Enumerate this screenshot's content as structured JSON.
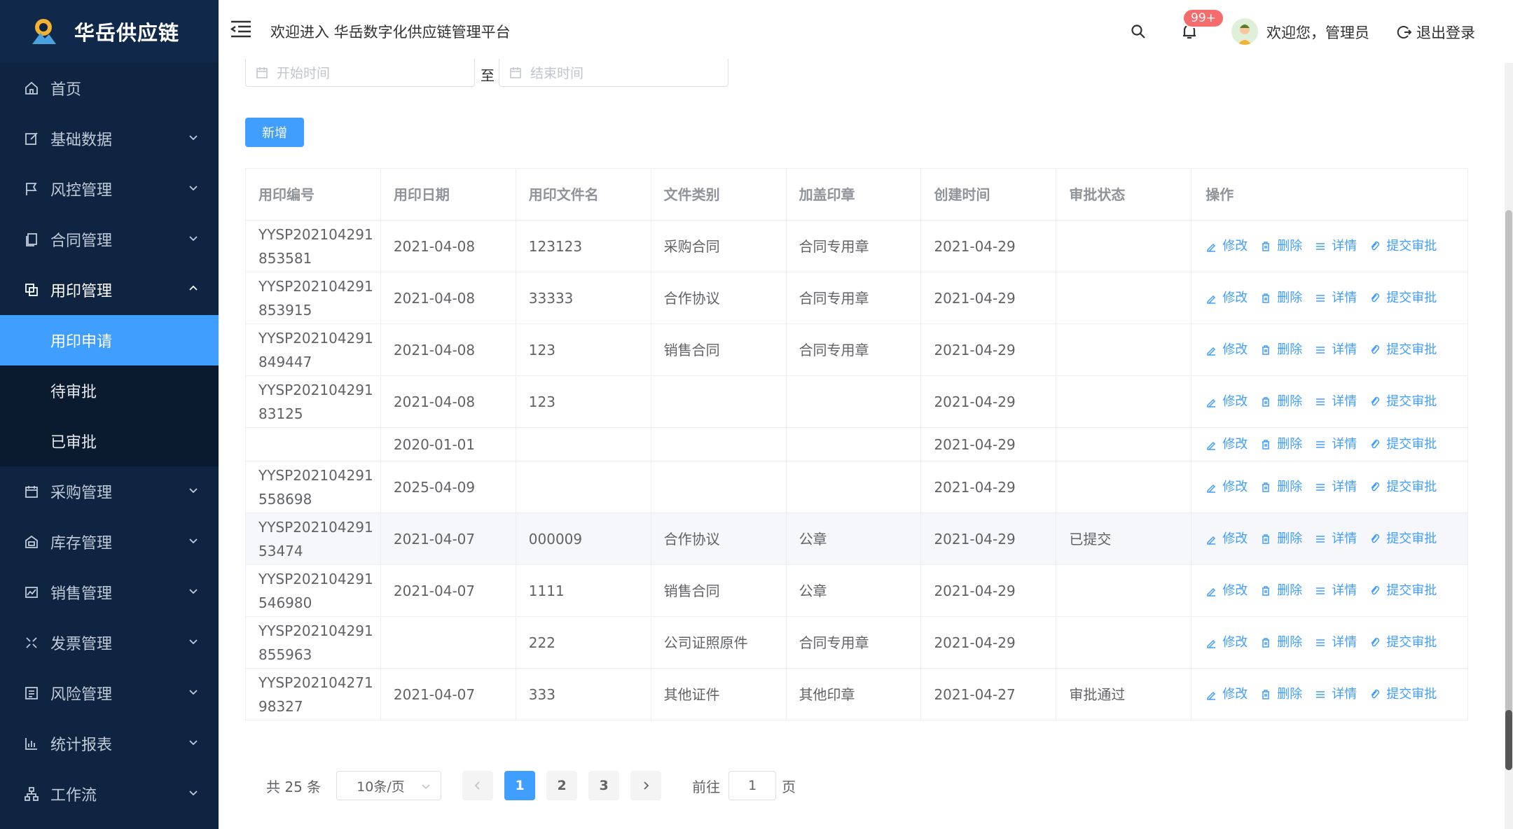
{
  "app": {
    "logo_text": "华岳供应链"
  },
  "header": {
    "welcome": "欢迎进入 华岳数字化供应链管理平台",
    "badge": "99+",
    "greeting": "欢迎您，管理员",
    "logout": "退出登录"
  },
  "sidebar": {
    "items": [
      {
        "label": "首页",
        "icon": "home-icon"
      },
      {
        "label": "基础数据",
        "icon": "edit-icon"
      },
      {
        "label": "风控管理",
        "icon": "flag-icon"
      },
      {
        "label": "合同管理",
        "icon": "document-copy-icon"
      },
      {
        "label": "用印管理",
        "icon": "copy-stamp-icon"
      },
      {
        "label": "用印申请",
        "icon": ""
      },
      {
        "label": "待审批",
        "icon": ""
      },
      {
        "label": "已审批",
        "icon": ""
      },
      {
        "label": "采购管理",
        "icon": "calendar-icon"
      },
      {
        "label": "库存管理",
        "icon": "warehouse-icon"
      },
      {
        "label": "销售管理",
        "icon": "trend-chart-icon"
      },
      {
        "label": "发票管理",
        "icon": "scan-icon"
      },
      {
        "label": "风险管理",
        "icon": "list-icon"
      },
      {
        "label": "统计报表",
        "icon": "bar-chart-icon"
      },
      {
        "label": "工作流",
        "icon": "org-chart-icon"
      }
    ]
  },
  "filters": {
    "start_placeholder": "开始时间",
    "separator": "至",
    "end_placeholder": "结束时间"
  },
  "toolbar": {
    "add_label": "新增"
  },
  "table": {
    "headers": [
      "用印编号",
      "用印日期",
      "用印文件名",
      "文件类别",
      "加盖印章",
      "创建时间",
      "审批状态",
      "操作"
    ],
    "ops": [
      "修改",
      "删除",
      "详情",
      "提交审批"
    ],
    "rows": [
      {
        "no": "YYSP202104291853581",
        "date": "2021-04-08",
        "file": "123123",
        "type": "采购合同",
        "seal": "合同专用章",
        "created": "2021-04-29",
        "status": ""
      },
      {
        "no": "YYSP202104291853915",
        "date": "2021-04-08",
        "file": "33333",
        "type": "合作协议",
        "seal": "合同专用章",
        "created": "2021-04-29",
        "status": ""
      },
      {
        "no": "YYSP202104291849447",
        "date": "2021-04-08",
        "file": "123",
        "type": "销售合同",
        "seal": "合同专用章",
        "created": "2021-04-29",
        "status": ""
      },
      {
        "no": "YYSP20210429183125",
        "date": "2021-04-08",
        "file": "123",
        "type": "",
        "seal": "",
        "created": "2021-04-29",
        "status": ""
      },
      {
        "no": "",
        "date": "2020-01-01",
        "file": "",
        "type": "",
        "seal": "",
        "created": "2021-04-29",
        "status": ""
      },
      {
        "no": "YYSP202104291558698",
        "date": "2025-04-09",
        "file": "",
        "type": "",
        "seal": "",
        "created": "2021-04-29",
        "status": ""
      },
      {
        "no": "YYSP20210429153474",
        "date": "2021-04-07",
        "file": "000009",
        "type": "合作协议",
        "seal": "公章",
        "created": "2021-04-29",
        "status": "已提交"
      },
      {
        "no": "YYSP202104291546980",
        "date": "2021-04-07",
        "file": "1111",
        "type": "销售合同",
        "seal": "公章",
        "created": "2021-04-29",
        "status": ""
      },
      {
        "no": "YYSP202104291855963",
        "date": "",
        "file": "222",
        "type": "公司证照原件",
        "seal": "合同专用章",
        "created": "2021-04-29",
        "status": ""
      },
      {
        "no": "YYSP20210427198327",
        "date": "2021-04-07",
        "file": "333",
        "type": "其他证件",
        "seal": "其他印章",
        "created": "2021-04-27",
        "status": "审批通过"
      }
    ]
  },
  "pagination": {
    "total": "共 25 条",
    "page_size": "10条/页",
    "pages": [
      "1",
      "2",
      "3"
    ],
    "goto_label": "前往",
    "goto_value": "1",
    "goto_suffix": "页"
  }
}
